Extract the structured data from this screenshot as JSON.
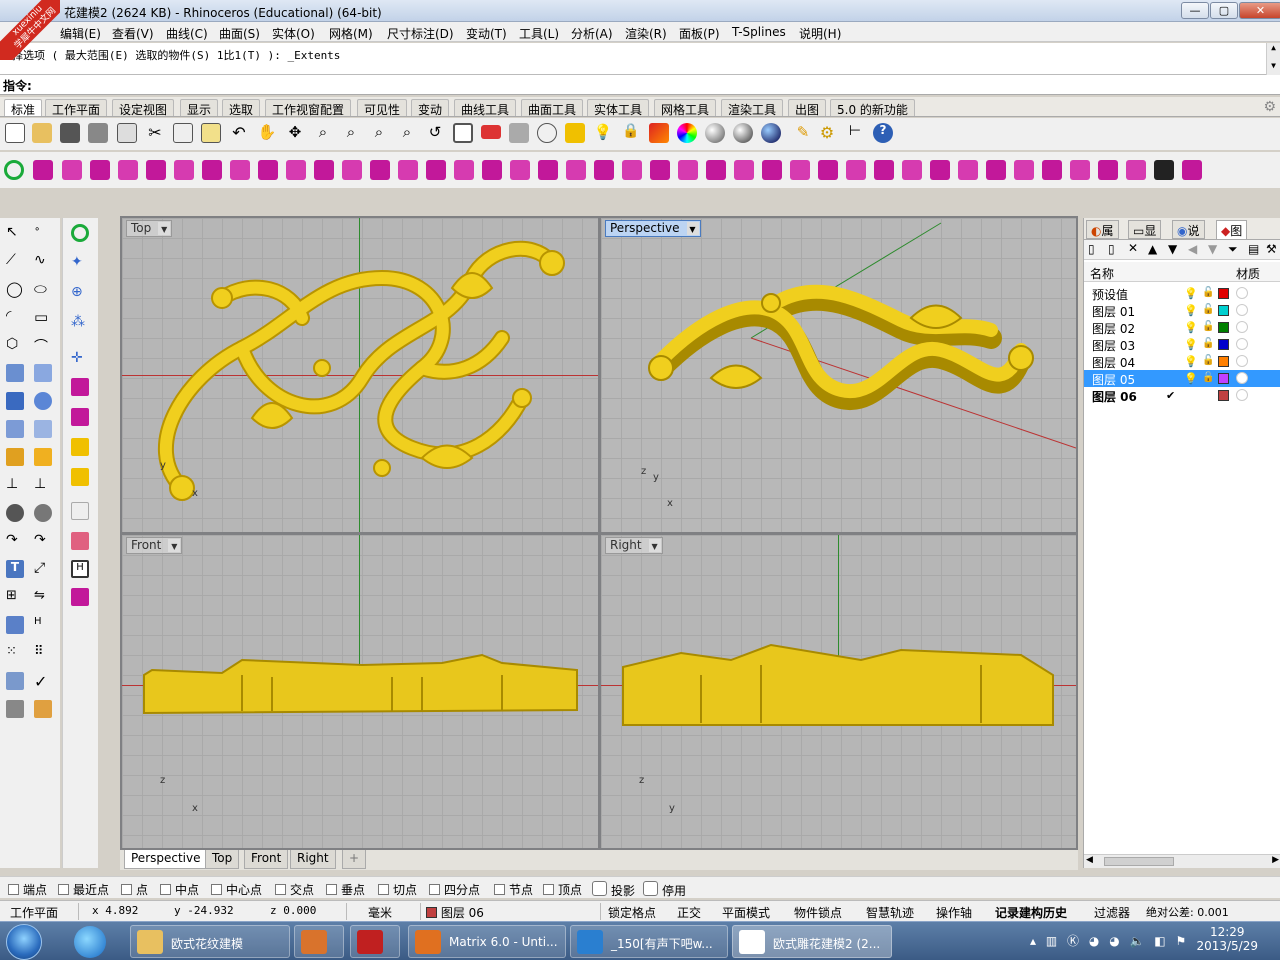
{
  "window": {
    "title": "花建模2 (2624 KB) - Rhinoceros (Educational) (64-bit)",
    "min": "—",
    "max": "▢",
    "close": "✕"
  },
  "logo": {
    "line1": "xuexiniu",
    "line2": "学犀牛中文网"
  },
  "menu": [
    "编辑(E)",
    "查看(V)",
    "曲线(C)",
    "曲面(S)",
    "实体(O)",
    "网格(M)",
    "尺寸标注(D)",
    "变动(T)",
    "工具(L)",
    "分析(A)",
    "渲染(R)",
    "面板(P)",
    "T-Splines",
    "说明(H)"
  ],
  "command": {
    "history": "择选项 ( 最大范围(E) 选取的物件(S) 1比1(T) ): _Extents",
    "prompt": "指令:",
    "input": ""
  },
  "toolbar_tabs": [
    "标准",
    "工作平面",
    "设定视图",
    "显示",
    "选取",
    "工作视窗配置",
    "可见性",
    "变动",
    "曲线工具",
    "曲面工具",
    "实体工具",
    "网格工具",
    "渲染工具",
    "出图",
    "5.0 的新功能"
  ],
  "active_toolbar_tab": "标准",
  "viewports": {
    "top": {
      "label": "Top"
    },
    "perspective": {
      "label": "Perspective"
    },
    "front": {
      "label": "Front"
    },
    "right": {
      "label": "Right"
    }
  },
  "axes": {
    "top": {
      "a": "y",
      "b": "x"
    },
    "persp": {
      "a": "z",
      "b": "y",
      "c": "x"
    },
    "front": {
      "a": "z",
      "b": "x"
    },
    "right": {
      "a": "z",
      "b": "y"
    }
  },
  "viewport_tabs": [
    "Perspective",
    "Top",
    "Front",
    "Right"
  ],
  "viewport_tab_add": "+",
  "panel": {
    "tabs": [
      "属",
      "显",
      "说",
      "图"
    ],
    "columns": {
      "name": "名称",
      "material": "材质"
    },
    "layers": [
      {
        "name": "预设值",
        "color": "#e00000",
        "current": false,
        "selected": false
      },
      {
        "name": "图层 01",
        "color": "#00d0d0",
        "current": false,
        "selected": false
      },
      {
        "name": "图层 02",
        "color": "#008000",
        "current": false,
        "selected": false
      },
      {
        "name": "图层 03",
        "color": "#0000cc",
        "current": false,
        "selected": false
      },
      {
        "name": "图层 04",
        "color": "#ff7f00",
        "current": false,
        "selected": false
      },
      {
        "name": "图层 05",
        "color": "#c040ff",
        "current": false,
        "selected": true
      },
      {
        "name": "图层 06",
        "color": "#c04040",
        "current": true,
        "selected": false
      }
    ],
    "current_mark": "✔"
  },
  "osnaps": [
    {
      "label": "端点",
      "checked": false
    },
    {
      "label": "最近点",
      "checked": false
    },
    {
      "label": "点",
      "checked": false
    },
    {
      "label": "中点",
      "checked": false
    },
    {
      "label": "中心点",
      "checked": false
    },
    {
      "label": "交点",
      "checked": false
    },
    {
      "label": "垂点",
      "checked": false
    },
    {
      "label": "切点",
      "checked": false
    },
    {
      "label": "四分点",
      "checked": false
    },
    {
      "label": "节点",
      "checked": false
    },
    {
      "label": "顶点",
      "checked": false
    },
    {
      "label": "投影",
      "checked": false
    },
    {
      "label": "停用",
      "checked": false
    }
  ],
  "status": {
    "cplane": "工作平面",
    "x": "x 4.892",
    "y": "y -24.932",
    "z": "z 0.000",
    "units": "毫米",
    "layer": "图层 06",
    "layer_color": "#c04040",
    "grid_snap": "锁定格点",
    "ortho": "正交",
    "planar": "平面模式",
    "osnap": "物件锁点",
    "smarttrack": "智慧轨迹",
    "gumball": "操作轴",
    "history": "记录建构历史",
    "filter": "过滤器",
    "tolerance": "绝对公差: 0.001"
  },
  "taskbar": {
    "items": [
      {
        "label": "欧式花纹建模",
        "color": "#e8c060"
      },
      {
        "label": "",
        "color": "#d9732c"
      },
      {
        "label": "",
        "color": "#c02020"
      },
      {
        "label": "Matrix 6.0 - Unti...",
        "color": "#e07020"
      },
      {
        "label": "_150[有声下吧w...",
        "color": "#2a7fd0"
      },
      {
        "label": "欧式雕花建模2 (2...",
        "color": "#ffffff"
      }
    ],
    "time": "12:29",
    "date": "2013/5/29"
  },
  "colors": {
    "accent": "#3399ff",
    "model": "#e8c71c",
    "model_shadow": "#a88a00",
    "grid_bg": "#b6b6b6",
    "x_axis": "#b33333",
    "y_axis": "#2e8b2e"
  }
}
